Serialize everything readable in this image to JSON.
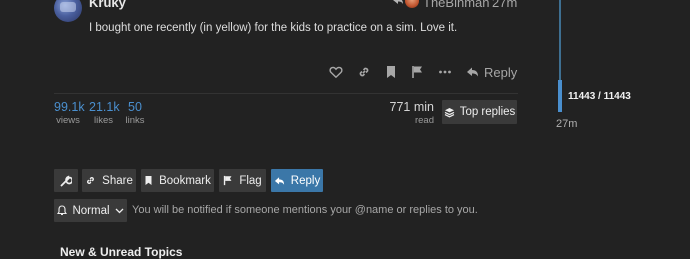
{
  "post": {
    "username": "Kruky",
    "reply_to": "TheBinman",
    "age": "27m",
    "body": "I bought one recently (in yellow) for the kids to practice on a sim. Love it.",
    "actions": {
      "reply_label": "Reply"
    }
  },
  "topic_map": {
    "stats": [
      {
        "value": "99.1k",
        "label": "views"
      },
      {
        "value": "21.1k",
        "label": "likes"
      },
      {
        "value": "50",
        "label": "links"
      }
    ],
    "read_time": "771 min",
    "read_label": "read",
    "top_replies_label": "Top replies"
  },
  "timeline": {
    "count": "11443 / 11443",
    "age": "27m",
    "progress": 1.0
  },
  "footer": {
    "share_label": "Share",
    "bookmark_label": "Bookmark",
    "flag_label": "Flag",
    "reply_label": "Reply",
    "notification_level": "Normal",
    "notification_desc": "You will be notified if someone mentions your @name or replies to you."
  },
  "section": {
    "title": "New & Unread Topics"
  },
  "colors": {
    "background": "#222222",
    "accent": "#4a8fce",
    "primary_button": "#3b77a8",
    "button": "#3a3a3a"
  }
}
